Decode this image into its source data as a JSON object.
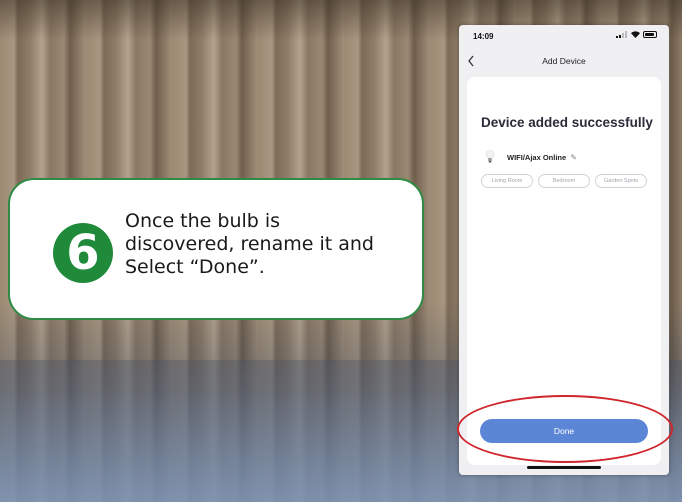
{
  "callout": {
    "step_number": "6",
    "text": "Once the bulb is\ndiscovered, rename it and\nSelect “Done”."
  },
  "phone": {
    "status_time": "14:09",
    "nav_title": "Add Device",
    "card_title": "Device added successfully",
    "device_name": "WIFI/Ajax Online",
    "rooms": [
      "Living Room",
      "Bedroom",
      "Garden Spots"
    ],
    "done_label": "Done"
  },
  "colors": {
    "callout_border": "#2e8b45",
    "step_badge": "#1f8a3a",
    "done_button": "#5b86d6",
    "highlight": "#d0262b"
  },
  "icons": [
    "back-icon",
    "bulb-icon",
    "edit-icon",
    "signal-icon",
    "wifi-icon",
    "battery-icon"
  ]
}
